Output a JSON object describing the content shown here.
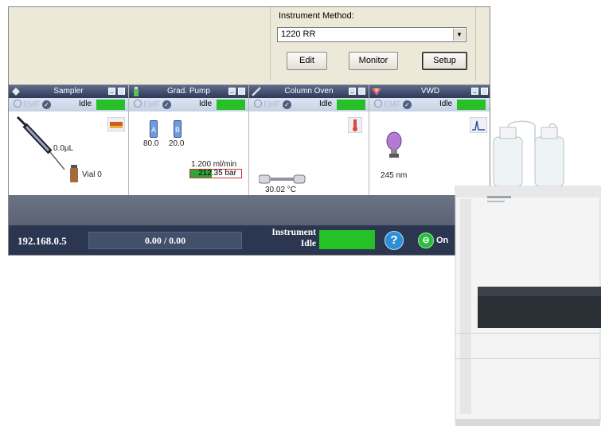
{
  "method": {
    "label": "Instrument Method:",
    "selected": "1220 RR",
    "edit": "Edit",
    "monitor": "Monitor",
    "setup": "Setup"
  },
  "modules": [
    {
      "title": "Sampler",
      "emf": "EMF",
      "status": "Idle",
      "volume": "0.0µL",
      "vial": "Vial 0"
    },
    {
      "title": "Grad. Pump",
      "emf": "EMF",
      "status": "Idle",
      "bottle_a": "A",
      "bottle_b": "B",
      "val_a": "80.0",
      "val_b": "20.0",
      "flow": "1.200 ml/min",
      "pressure": "212.35 bar"
    },
    {
      "title": "Column Oven",
      "emf": "EMF",
      "status": "Idle",
      "temp": "30.02 °C"
    },
    {
      "title": "VWD",
      "emf": "EMF",
      "status": "Idle",
      "wavelength": "245 nm"
    }
  ],
  "status_bar": {
    "ip": "192.168.0.5",
    "progress": "0.00 / 0.00",
    "instrument": "Instrument",
    "instrument_state": "Idle",
    "help": "?",
    "power": "On"
  },
  "colors": {
    "status_green": "#28c028",
    "header_navy": "#2f3a58",
    "status_bar": "#2b3750",
    "help_blue": "#2c8fd6"
  }
}
